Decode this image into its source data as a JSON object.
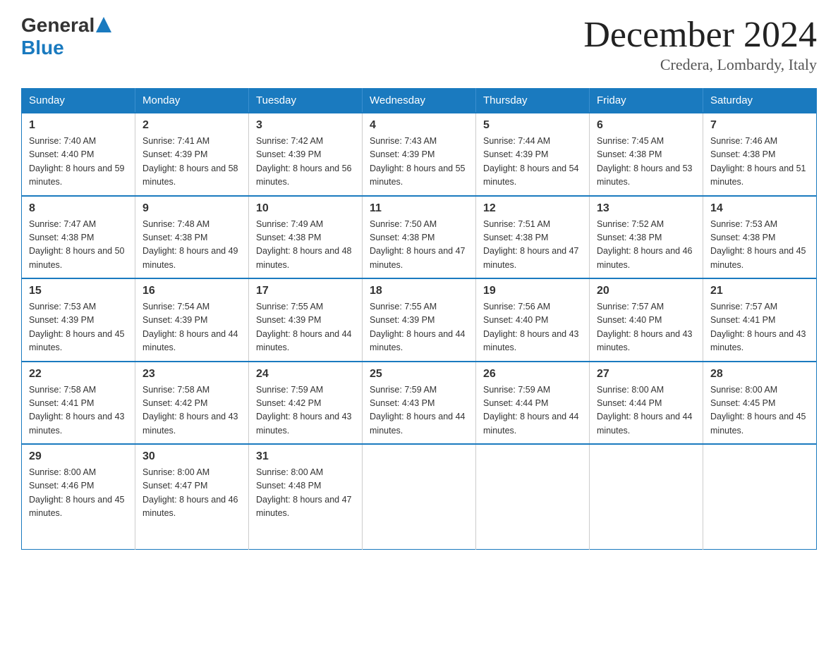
{
  "logo": {
    "general": "General",
    "blue": "Blue",
    "arrow": "▲"
  },
  "title": "December 2024",
  "location": "Credera, Lombardy, Italy",
  "days_of_week": [
    "Sunday",
    "Monday",
    "Tuesday",
    "Wednesday",
    "Thursday",
    "Friday",
    "Saturday"
  ],
  "weeks": [
    [
      {
        "day": "1",
        "sunrise": "7:40 AM",
        "sunset": "4:40 PM",
        "daylight": "8 hours and 59 minutes."
      },
      {
        "day": "2",
        "sunrise": "7:41 AM",
        "sunset": "4:39 PM",
        "daylight": "8 hours and 58 minutes."
      },
      {
        "day": "3",
        "sunrise": "7:42 AM",
        "sunset": "4:39 PM",
        "daylight": "8 hours and 56 minutes."
      },
      {
        "day": "4",
        "sunrise": "7:43 AM",
        "sunset": "4:39 PM",
        "daylight": "8 hours and 55 minutes."
      },
      {
        "day": "5",
        "sunrise": "7:44 AM",
        "sunset": "4:39 PM",
        "daylight": "8 hours and 54 minutes."
      },
      {
        "day": "6",
        "sunrise": "7:45 AM",
        "sunset": "4:38 PM",
        "daylight": "8 hours and 53 minutes."
      },
      {
        "day": "7",
        "sunrise": "7:46 AM",
        "sunset": "4:38 PM",
        "daylight": "8 hours and 51 minutes."
      }
    ],
    [
      {
        "day": "8",
        "sunrise": "7:47 AM",
        "sunset": "4:38 PM",
        "daylight": "8 hours and 50 minutes."
      },
      {
        "day": "9",
        "sunrise": "7:48 AM",
        "sunset": "4:38 PM",
        "daylight": "8 hours and 49 minutes."
      },
      {
        "day": "10",
        "sunrise": "7:49 AM",
        "sunset": "4:38 PM",
        "daylight": "8 hours and 48 minutes."
      },
      {
        "day": "11",
        "sunrise": "7:50 AM",
        "sunset": "4:38 PM",
        "daylight": "8 hours and 47 minutes."
      },
      {
        "day": "12",
        "sunrise": "7:51 AM",
        "sunset": "4:38 PM",
        "daylight": "8 hours and 47 minutes."
      },
      {
        "day": "13",
        "sunrise": "7:52 AM",
        "sunset": "4:38 PM",
        "daylight": "8 hours and 46 minutes."
      },
      {
        "day": "14",
        "sunrise": "7:53 AM",
        "sunset": "4:38 PM",
        "daylight": "8 hours and 45 minutes."
      }
    ],
    [
      {
        "day": "15",
        "sunrise": "7:53 AM",
        "sunset": "4:39 PM",
        "daylight": "8 hours and 45 minutes."
      },
      {
        "day": "16",
        "sunrise": "7:54 AM",
        "sunset": "4:39 PM",
        "daylight": "8 hours and 44 minutes."
      },
      {
        "day": "17",
        "sunrise": "7:55 AM",
        "sunset": "4:39 PM",
        "daylight": "8 hours and 44 minutes."
      },
      {
        "day": "18",
        "sunrise": "7:55 AM",
        "sunset": "4:39 PM",
        "daylight": "8 hours and 44 minutes."
      },
      {
        "day": "19",
        "sunrise": "7:56 AM",
        "sunset": "4:40 PM",
        "daylight": "8 hours and 43 minutes."
      },
      {
        "day": "20",
        "sunrise": "7:57 AM",
        "sunset": "4:40 PM",
        "daylight": "8 hours and 43 minutes."
      },
      {
        "day": "21",
        "sunrise": "7:57 AM",
        "sunset": "4:41 PM",
        "daylight": "8 hours and 43 minutes."
      }
    ],
    [
      {
        "day": "22",
        "sunrise": "7:58 AM",
        "sunset": "4:41 PM",
        "daylight": "8 hours and 43 minutes."
      },
      {
        "day": "23",
        "sunrise": "7:58 AM",
        "sunset": "4:42 PM",
        "daylight": "8 hours and 43 minutes."
      },
      {
        "day": "24",
        "sunrise": "7:59 AM",
        "sunset": "4:42 PM",
        "daylight": "8 hours and 43 minutes."
      },
      {
        "day": "25",
        "sunrise": "7:59 AM",
        "sunset": "4:43 PM",
        "daylight": "8 hours and 44 minutes."
      },
      {
        "day": "26",
        "sunrise": "7:59 AM",
        "sunset": "4:44 PM",
        "daylight": "8 hours and 44 minutes."
      },
      {
        "day": "27",
        "sunrise": "8:00 AM",
        "sunset": "4:44 PM",
        "daylight": "8 hours and 44 minutes."
      },
      {
        "day": "28",
        "sunrise": "8:00 AM",
        "sunset": "4:45 PM",
        "daylight": "8 hours and 45 minutes."
      }
    ],
    [
      {
        "day": "29",
        "sunrise": "8:00 AM",
        "sunset": "4:46 PM",
        "daylight": "8 hours and 45 minutes."
      },
      {
        "day": "30",
        "sunrise": "8:00 AM",
        "sunset": "4:47 PM",
        "daylight": "8 hours and 46 minutes."
      },
      {
        "day": "31",
        "sunrise": "8:00 AM",
        "sunset": "4:48 PM",
        "daylight": "8 hours and 47 minutes."
      },
      null,
      null,
      null,
      null
    ]
  ]
}
